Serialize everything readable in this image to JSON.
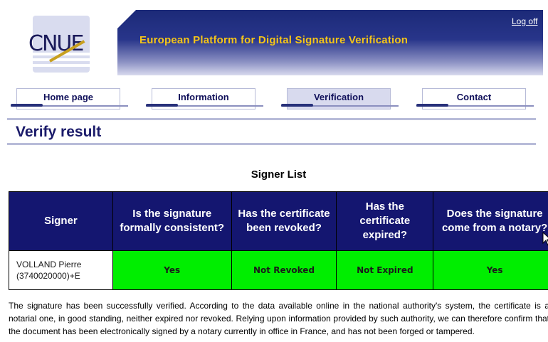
{
  "header": {
    "logo_text": "CNUE",
    "title": "European Platform for Digital Signature Verification",
    "logoff_label": "Log off"
  },
  "nav": {
    "items": [
      {
        "label": "Home page",
        "active": false
      },
      {
        "label": "Information",
        "active": false
      },
      {
        "label": "Verification",
        "active": true
      },
      {
        "label": "Contact",
        "active": false
      }
    ]
  },
  "page": {
    "title": "Verify result",
    "list_title": "Signer List"
  },
  "table": {
    "headers": [
      "Signer",
      "Is the signature formally consistent?",
      "Has the certificate been revoked?",
      "Has the certificate expired?",
      "Does the signature come from a notary?"
    ],
    "rows": [
      {
        "signer_name": "VOLLAND Pierre",
        "signer_id": "(3740020000)+E",
        "consistent": "Yes",
        "revoked": "Not Revoked",
        "expired": "Not Expired",
        "notary": "Yes"
      }
    ]
  },
  "result_text": "The signature has been successfully verified. According to the data available online in the national authority's system, the certificate is a notarial one, in good standing, neither expired nor revoked. Relying upon information provided by such authority, we can therefore confirm that the document has been electronically signed by a notary currently in office in France, and has not been forged or tampered.",
  "colors": {
    "accent": "#141670",
    "ok": "#00ee00",
    "title_gold": "#f5c518"
  }
}
